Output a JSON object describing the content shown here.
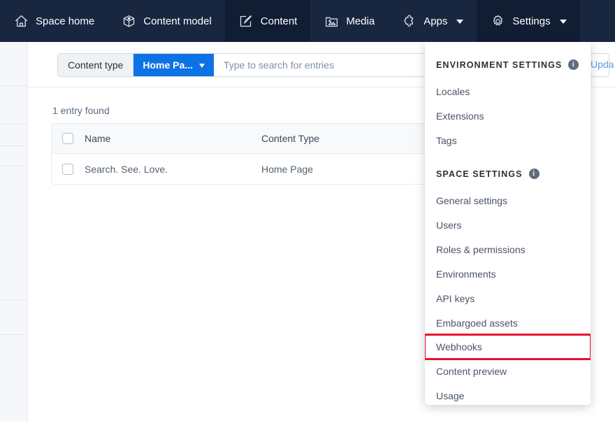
{
  "topnav": {
    "items": [
      {
        "label": "Space home",
        "icon": "home-icon",
        "active": false,
        "caret": false
      },
      {
        "label": "Content model",
        "icon": "content-model-icon",
        "active": false,
        "caret": false
      },
      {
        "label": "Content",
        "icon": "content-icon",
        "active": true,
        "caret": false
      },
      {
        "label": "Media",
        "icon": "media-icon",
        "active": false,
        "caret": false
      },
      {
        "label": "Apps",
        "icon": "apps-icon",
        "active": false,
        "caret": true
      },
      {
        "label": "Settings",
        "icon": "gear-icon",
        "active": true,
        "caret": true
      }
    ]
  },
  "toolbar": {
    "content_type_label": "Content type",
    "selected_content_type": "Home Pa...",
    "search_placeholder": "Type to search for entries",
    "search_value": "",
    "update_label": "Upda"
  },
  "main": {
    "entry_count_text": "1 entry found",
    "table": {
      "headers": {
        "name": "Name",
        "content_type": "Content Type"
      },
      "rows": [
        {
          "name": "Search. See. Love.",
          "content_type": "Home Page"
        }
      ]
    }
  },
  "settings_dropdown": {
    "sections": [
      {
        "title": "ENVIRONMENT SETTINGS",
        "has_info": true,
        "items": [
          "Locales",
          "Extensions",
          "Tags"
        ]
      },
      {
        "title": "SPACE SETTINGS",
        "has_info": true,
        "items": [
          "General settings",
          "Users",
          "Roles & permissions",
          "Environments",
          "API keys",
          "Embargoed assets",
          "Webhooks",
          "Content preview",
          "Usage"
        ]
      }
    ],
    "highlighted_item": "Webhooks"
  },
  "colors": {
    "nav_background": "#192640",
    "nav_active": "#111d33",
    "accent_blue": "#0d73e5",
    "highlight_red": "#e8112d",
    "panel_background": "#f5f7fa"
  }
}
